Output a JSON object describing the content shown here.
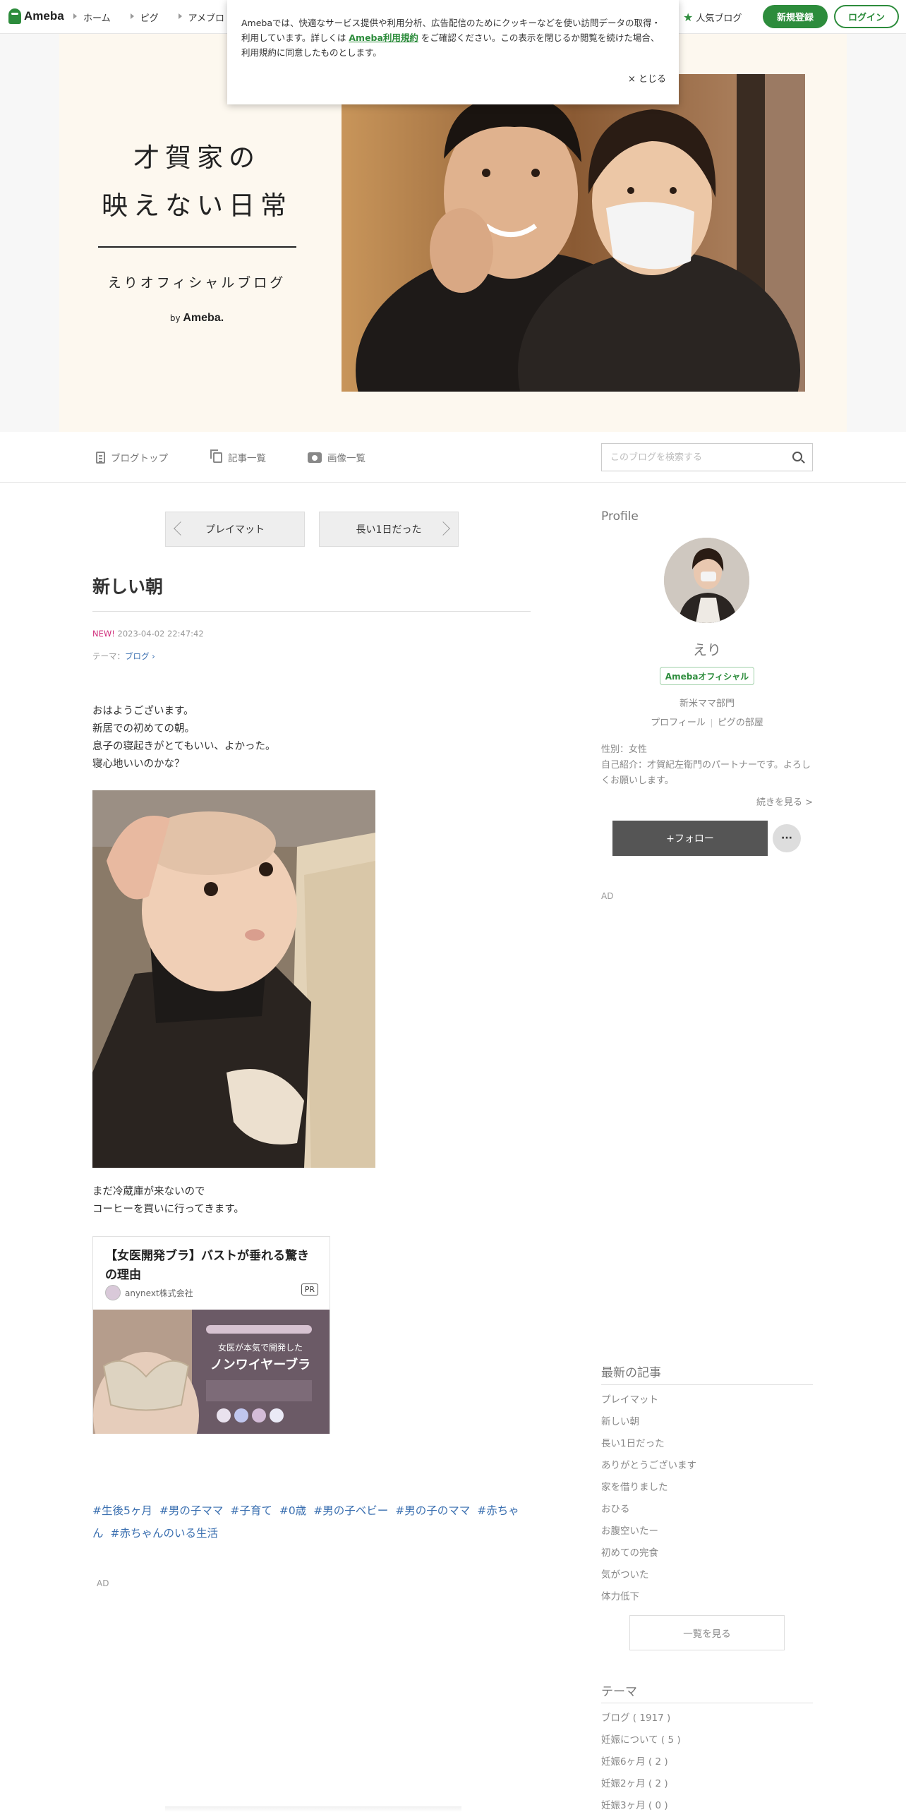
{
  "topnav": {
    "brand": "Ameba",
    "links": [
      "ホーム",
      "ピグ",
      "アメブロ"
    ],
    "popular": "人気ブログ",
    "register": "新規登録",
    "login": "ログイン"
  },
  "cookie": {
    "text1": "Amebaでは、快適なサービス提供や利用分析、広告配信のためにクッキーなどを使い訪問データの取得・利用しています。詳しくは",
    "link": "Ameba利用規約",
    "text2": "をご確認ください。この表示を閉じるか閲覧を続けた場合、利用規約に同意したものとします。",
    "close": "× とじる"
  },
  "banner": {
    "title_line1": "才賀家の",
    "title_line2": "映えない日常",
    "subtitle": "えりオフィシャルブログ",
    "by": "by",
    "brand": "Ameba."
  },
  "subnav": {
    "blog_top": "ブログトップ",
    "articles": "記事一覧",
    "images": "画像一覧",
    "search_placeholder": "このブログを検索する"
  },
  "pager": {
    "prev": "プレイマット",
    "next": "長い1日だった"
  },
  "article": {
    "title": "新しい朝",
    "new_label": "NEW!",
    "datetime": "2023-04-02 22:47:42",
    "theme_label": "テーマ：",
    "theme": "ブログ",
    "paragraph1": [
      "おはようございます。",
      "新居での初めての朝。",
      "息子の寝起きがとてもいい、よかった。",
      "寝心地いいのかな？"
    ],
    "paragraph2": [
      "まだ冷蔵庫が来ないので",
      "コーヒーを買いに行ってきます。"
    ],
    "hashtags": [
      "#生後5ヶ月",
      "#男の子ママ",
      "#子育て",
      "#0歳",
      "#男の子ベビー",
      "#男の子のママ",
      "#赤ちゃん",
      "#赤ちゃんのいる生活"
    ],
    "ad_label": "AD"
  },
  "ad_card": {
    "title": "【女医開発ブラ】バストが垂れる驚きの理由",
    "company": "anynext株式会社",
    "badge": "PR",
    "img_text1": "女医が本気で開発した",
    "img_text2": "ノンワイヤーブラ"
  },
  "sidebar": {
    "profile_heading": "Profile",
    "name": "えり",
    "badge": "Amebaオフィシャル",
    "category": "新米ママ部門",
    "profile_link": "プロフィール",
    "pig_link": "ピグの部屋",
    "gender": "性別：女性",
    "intro": "自己紹介：才賀紀左衛門のパートナーです。よろしくお願いします。",
    "more": "続きを見る >",
    "follow": "+フォロー",
    "dots": "···",
    "ad_label": "AD",
    "recent_heading": "最新の記事",
    "recent": [
      "プレイマット",
      "新しい朝",
      "長い1日だった",
      "ありがとうございます",
      "家を借りました",
      "おひる",
      "お腹空いたー",
      "初めての完食",
      "気がついた",
      "体力低下"
    ],
    "all_button": "一覧を見る",
    "theme_heading": "テーマ",
    "themes": [
      "ブログ ( 1917 )",
      "妊娠について ( 5 )",
      "妊娠6ヶ月 ( 2 )",
      "妊娠2ヶ月 ( 2 )",
      "妊娠3ヶ月 ( 0 )"
    ]
  },
  "colors": {
    "brand_green": "#2d8c3c",
    "link_blue": "#3a6fb0",
    "new_pink": "#d0307c",
    "banner_bg": "#fdf8ef"
  }
}
